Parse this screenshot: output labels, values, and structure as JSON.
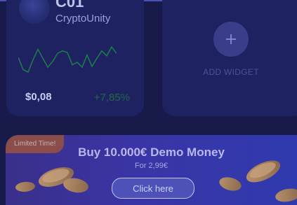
{
  "coin_card": {
    "ticker": "C01",
    "name": "CryptoUnity",
    "price": "$0,08",
    "change": "+7,85%",
    "sparkline": [
      42,
      27,
      24,
      39,
      52,
      41,
      30,
      37,
      47,
      50,
      48,
      33,
      36,
      30,
      45,
      31,
      41,
      50,
      44,
      55,
      47
    ],
    "sparkline_color": "#1c7a4c",
    "change_color": "#1f6a43"
  },
  "widget_card": {
    "add_label": "ADD WIDGET",
    "add_icon": "plus-icon"
  },
  "promo": {
    "badge": "Limited Time!",
    "title": "Buy 10.000€ Demo Money",
    "subtitle": "For 2,99€",
    "cta": "Click here",
    "coin_icon": "coin-stack-icon"
  }
}
